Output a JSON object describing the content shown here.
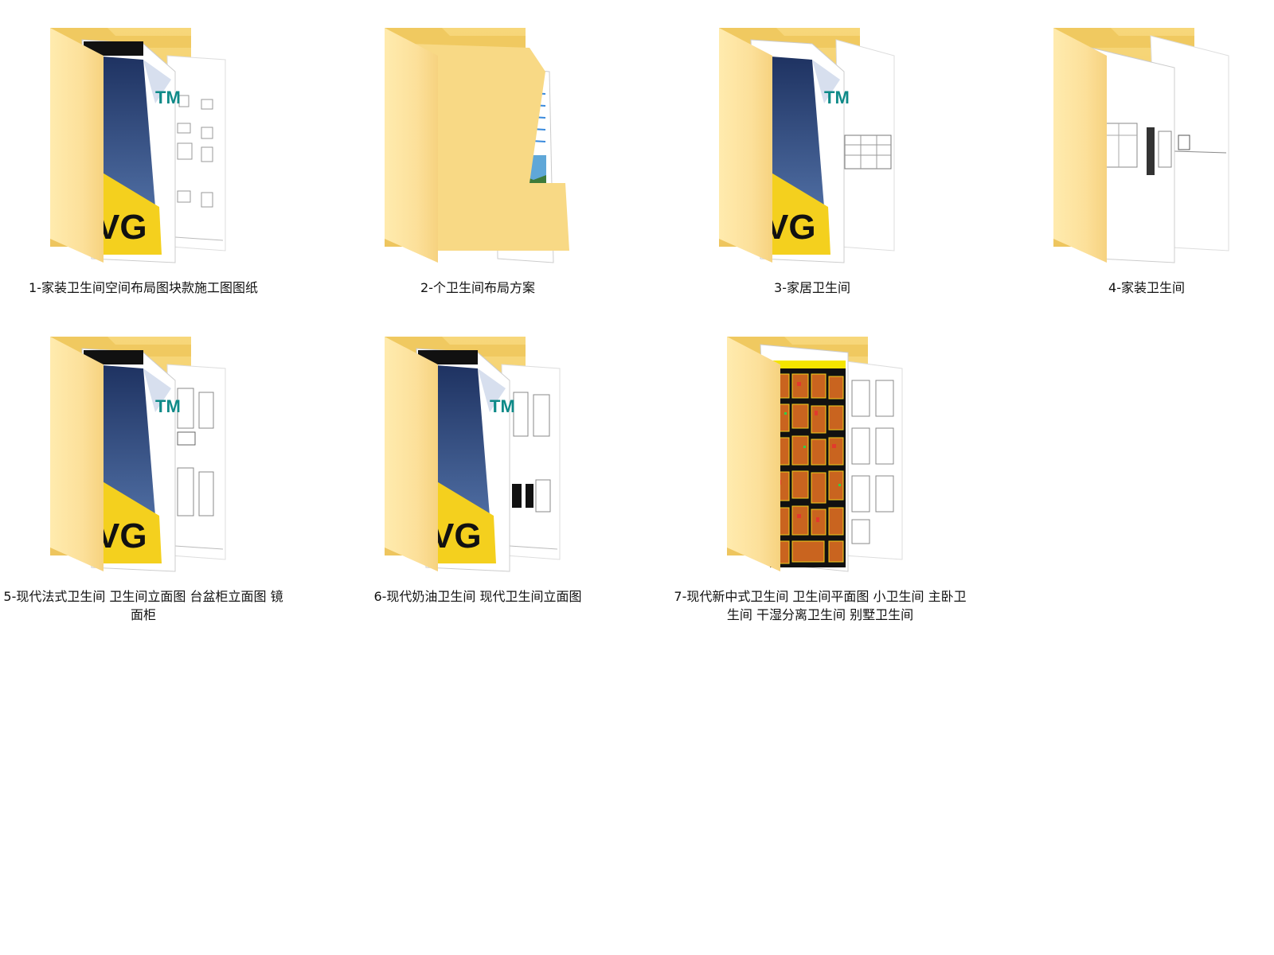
{
  "folders": [
    {
      "label": "1-家装卫生间空间布局图块款施工图图纸",
      "preview": "dwg-icon"
    },
    {
      "label": "2-个卫生间布局方案",
      "preview": "document-icon"
    },
    {
      "label": "3-家居卫生间",
      "preview": "dwg-icon"
    },
    {
      "label": "4-家装卫生间",
      "preview": "drawing-sheet-icon"
    },
    {
      "label": "5-现代法式卫生间 卫生间立面图 台盆柜立面图 镜面柜",
      "preview": "dwg-icon"
    },
    {
      "label": "6-现代奶油卫生间 现代卫生间立面图",
      "preview": "dwg-icon"
    },
    {
      "label": "7-现代新中式卫生间 卫生间平面图 小卫生间 主卧卫生间 干湿分离卫生间 别墅卫生间",
      "preview": "color-plan-icon"
    }
  ],
  "dwg_badge": "VG",
  "tm_mark": "TM",
  "colors": {
    "folder_back": "#F3CF6B",
    "folder_front": "#FCE09A",
    "dwg_blue": "#22386A",
    "dwg_yellow": "#F4D01E"
  }
}
